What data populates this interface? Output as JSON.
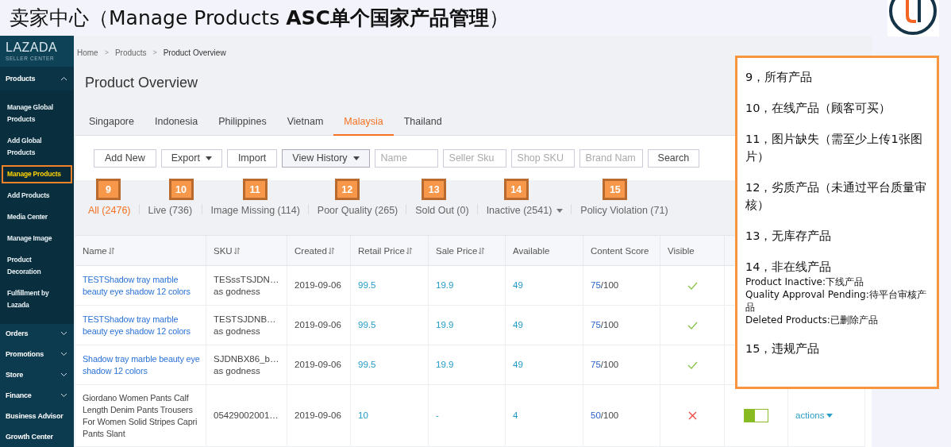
{
  "slide_title": "卖家中心（Manage Products **ASC单个国家产品管理**）",
  "sidebar": {
    "logo_title": "LAZADA",
    "logo_subtitle": "SELLER CENTER",
    "sections": [
      {
        "label": "Products",
        "kind": "group",
        "expanded": true,
        "children": [
          {
            "label": "Manage Global Products",
            "selected": false
          },
          {
            "label": "Add Global Products",
            "selected": false
          },
          {
            "label": "Manage Products",
            "selected": true
          },
          {
            "label": "Add Products",
            "selected": false
          },
          {
            "label": "Media Center",
            "selected": false
          },
          {
            "label": "Manage Image",
            "selected": false
          },
          {
            "label": "Product Decoration",
            "selected": false
          },
          {
            "label": "Fulfillment by Lazada",
            "selected": false
          }
        ]
      },
      {
        "label": "Orders",
        "kind": "group",
        "expanded": false
      },
      {
        "label": "Promotions",
        "kind": "group",
        "expanded": false
      },
      {
        "label": "Store",
        "kind": "group",
        "expanded": false
      },
      {
        "label": "Finance",
        "kind": "group",
        "expanded": false
      },
      {
        "label": "Business Advisor",
        "kind": "link"
      },
      {
        "label": "Growth Center",
        "kind": "link"
      }
    ]
  },
  "breadcrumb": {
    "separator": ">",
    "items": [
      "Home",
      "Products",
      "Product Overview"
    ]
  },
  "page_title": "Product Overview",
  "country_tabs": [
    {
      "label": "Singapore",
      "selected": false
    },
    {
      "label": "Indonesia",
      "selected": false
    },
    {
      "label": "Philippines",
      "selected": false
    },
    {
      "label": "Vietnam",
      "selected": false
    },
    {
      "label": "Malaysia",
      "selected": true
    },
    {
      "label": "Thailand",
      "selected": false
    }
  ],
  "toolbar": {
    "buttons": [
      {
        "label": "Add New",
        "kind": "button"
      },
      {
        "label": "Export",
        "kind": "dropdown"
      },
      {
        "label": "Import",
        "kind": "button"
      },
      {
        "label": "View History",
        "kind": "dropdown"
      }
    ],
    "filters": [
      {
        "placeholder": "Name"
      },
      {
        "placeholder": "Seller Sku"
      },
      {
        "placeholder": "Shop SKU"
      },
      {
        "placeholder": "Brand Nam"
      }
    ],
    "search": "Search"
  },
  "status_tabs": [
    {
      "label": "All (2476)",
      "selected": true,
      "badge": "9",
      "dropdown": false
    },
    {
      "label": "Live (736)",
      "selected": false,
      "badge": "10",
      "dropdown": false
    },
    {
      "label": "Image Missing (114)",
      "selected": false,
      "badge": "11",
      "dropdown": false
    },
    {
      "label": "Poor Quality (265)",
      "selected": false,
      "badge": "12",
      "dropdown": false
    },
    {
      "label": "Sold Out (0)",
      "selected": false,
      "badge": "13",
      "dropdown": false
    },
    {
      "label": "Inactive (2541)",
      "selected": false,
      "badge": "14",
      "dropdown": true
    },
    {
      "label": "Policy Violation (71)",
      "selected": false,
      "badge": "15",
      "dropdown": false
    }
  ],
  "table": {
    "columns": [
      {
        "label": "Name",
        "sortable": true
      },
      {
        "label": "SKU",
        "sortable": true
      },
      {
        "label": "Created",
        "sortable": true
      },
      {
        "label": "Retail Price",
        "sortable": true
      },
      {
        "label": "Sale Price",
        "sortable": true
      },
      {
        "label": "Available",
        "sortable": false
      },
      {
        "label": "Content Score",
        "sortable": false
      },
      {
        "label": "Visible",
        "sortable": false
      }
    ],
    "rows": [
      {
        "name": "TESTShadow tray marble beauty eye shadow 12 colors",
        "linked": true,
        "sku": "TESssTSJDN…",
        "sku_note": "as godness",
        "created": "2019-09-06",
        "retail_price": "99.5",
        "sale_price": "19.9",
        "available": "49",
        "score": "75",
        "score_total": "/100",
        "visible": true
      },
      {
        "name": "TESTShadow tray marble beauty eye shadow 12 colors",
        "linked": true,
        "sku": "TESTSJDNB…",
        "sku_note": "as godness",
        "created": "2019-09-06",
        "retail_price": "99.5",
        "sale_price": "19.9",
        "available": "49",
        "score": "75",
        "score_total": "/100",
        "visible": true
      },
      {
        "name": "Shadow tray marble beauty eye shadow 12 colors",
        "linked": true,
        "sku": "SJDNBX86_b…",
        "sku_note": "as godness",
        "created": "2019-09-06",
        "retail_price": "99.5",
        "sale_price": "19.9",
        "available": "49",
        "score": "75",
        "score_total": "/100",
        "visible": true
      },
      {
        "name": "Giordano Women Pants Calf Length Denim Pants Trousers For Women Solid Stripes Capri Pants Slant",
        "linked": false,
        "sku": "05429002001…",
        "created": "2019-09-06",
        "retail_price": "10",
        "sale_price": "-",
        "available": "4",
        "score": "50",
        "score_total": "/100",
        "visible": false,
        "active_on": true,
        "actions": "actions"
      }
    ]
  },
  "callout": {
    "notes": [
      {
        "heading": "9，所有产品"
      },
      {
        "heading": "10，在线产品（顾客可买）"
      },
      {
        "heading": "11，图片缺失（需至少上传1张图片）"
      },
      {
        "heading": "12，劣质产品（未通过平台质量审核）"
      },
      {
        "heading": "13，无库存产品"
      },
      {
        "heading": "14，非在线产品",
        "details": [
          "Product Inactive:下线产品",
          "Quality Approval Pending:待平台审核产品",
          "Deleted Products:已删除产品"
        ]
      },
      {
        "heading": "15，违规产品"
      }
    ]
  }
}
